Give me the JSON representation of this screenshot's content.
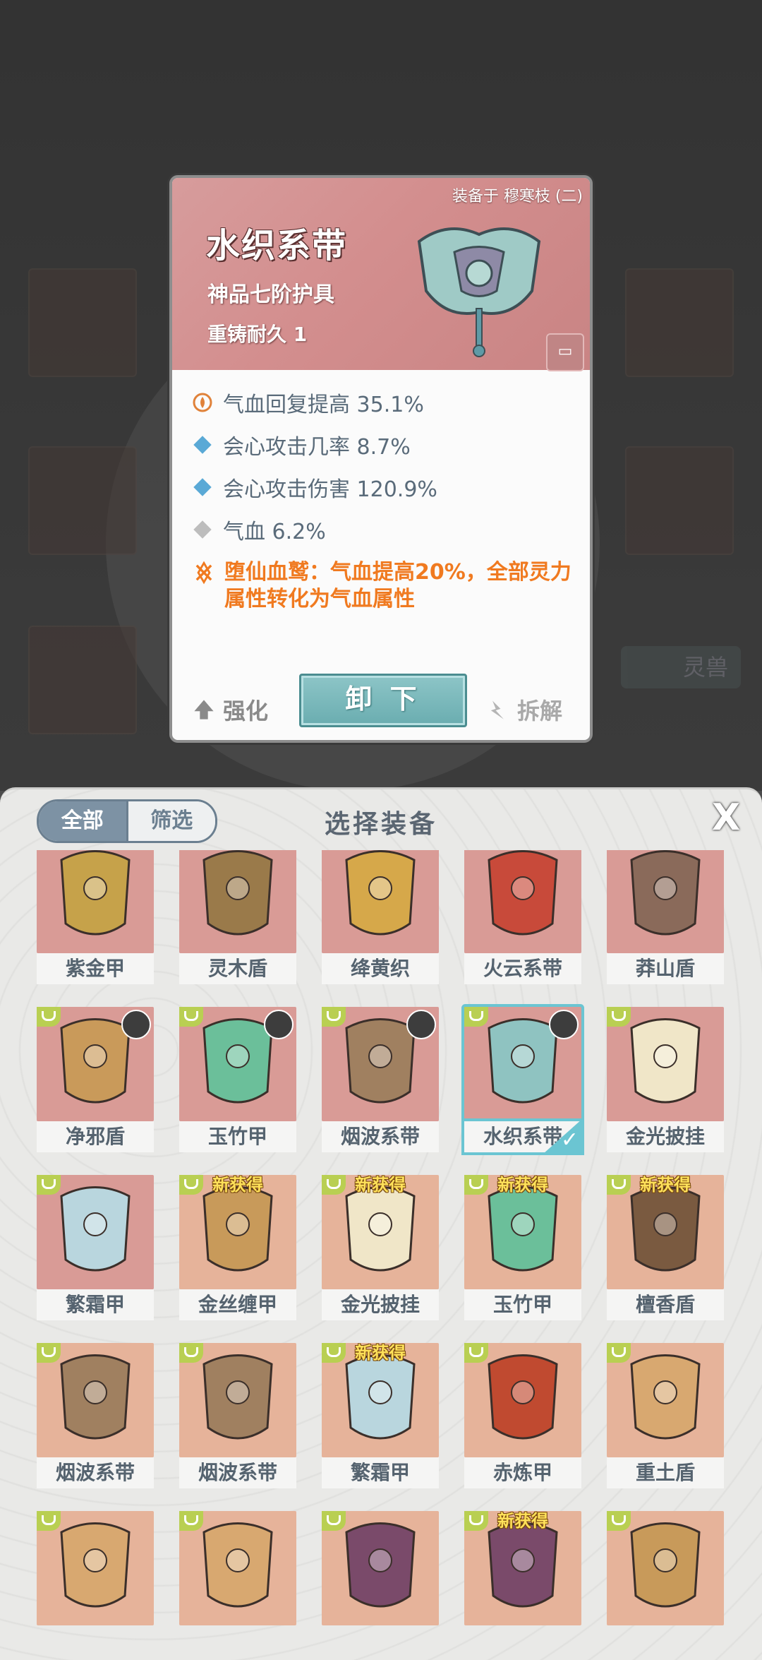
{
  "detail": {
    "equipped_on": "装备于 穆寒枝 (二)",
    "name": "水织系带",
    "grade": "神品七阶护具",
    "recast": "重铸耐久 1",
    "stats": [
      {
        "text": "气血回复提高 35.1%",
        "icon": "recovery-icon",
        "color": "#e0823a"
      },
      {
        "text": "会心攻击几率 8.7%",
        "icon": "diamond-icon",
        "color": "#5aa9d6"
      },
      {
        "text": "会心攻击伤害 120.9%",
        "icon": "diamond-icon",
        "color": "#5aa9d6"
      },
      {
        "text": "气血 6.2%",
        "icon": "diamond-icon",
        "color": "#b8b8b8"
      }
    ],
    "special": "堕仙血鹫：气血提高20%，全部灵力属性转化为气血属性",
    "strengthen_label": "强化",
    "unequip_label": "卸 下",
    "decompose_label": "拆解"
  },
  "background": {
    "side_label": "灵兽"
  },
  "panel": {
    "title": "选择装备",
    "filter_all": "全部",
    "filter_screen": "筛选",
    "close": "X",
    "new_badge": "新获得",
    "items": [
      {
        "name": "紫金甲",
        "bg": "red",
        "art": "#c6a24a",
        "tag": false,
        "new": false,
        "avatar": false
      },
      {
        "name": "灵木盾",
        "bg": "red",
        "art": "#9a7a4a",
        "tag": false,
        "new": false,
        "avatar": false
      },
      {
        "name": "绛黄织",
        "bg": "red",
        "art": "#d6a84a",
        "tag": false,
        "new": false,
        "avatar": false
      },
      {
        "name": "火云系带",
        "bg": "red",
        "art": "#c84a3a",
        "tag": false,
        "new": false,
        "avatar": false
      },
      {
        "name": "莽山盾",
        "bg": "red",
        "art": "#8a6a5a",
        "tag": false,
        "new": false,
        "avatar": false
      },
      {
        "name": "净邪盾",
        "bg": "red",
        "art": "#c99a5a",
        "tag": true,
        "new": false,
        "avatar": true
      },
      {
        "name": "玉竹甲",
        "bg": "red",
        "art": "#6bbf9a",
        "tag": true,
        "new": false,
        "avatar": true
      },
      {
        "name": "烟波系带",
        "bg": "red",
        "art": "#a08060",
        "tag": true,
        "new": false,
        "avatar": true
      },
      {
        "name": "水织系带",
        "bg": "red",
        "art": "#8fc3c1",
        "tag": true,
        "new": false,
        "avatar": true,
        "selected": true
      },
      {
        "name": "金光披挂",
        "bg": "red",
        "art": "#f0e6c8",
        "tag": true,
        "new": false,
        "avatar": false
      },
      {
        "name": "繁霜甲",
        "bg": "red",
        "art": "#b9d6de",
        "tag": true,
        "new": false,
        "avatar": false
      },
      {
        "name": "金丝缠甲",
        "bg": "orange",
        "art": "#c89a5a",
        "tag": true,
        "new": true,
        "avatar": false
      },
      {
        "name": "金光披挂",
        "bg": "orange",
        "art": "#f0e6c8",
        "tag": true,
        "new": true,
        "avatar": false
      },
      {
        "name": "玉竹甲",
        "bg": "orange",
        "art": "#6bbf9a",
        "tag": true,
        "new": true,
        "avatar": false
      },
      {
        "name": "檀香盾",
        "bg": "orange",
        "art": "#7a5a40",
        "tag": true,
        "new": true,
        "avatar": false
      },
      {
        "name": "烟波系带",
        "bg": "orange",
        "art": "#a08060",
        "tag": true,
        "new": false,
        "avatar": false
      },
      {
        "name": "烟波系带",
        "bg": "orange",
        "art": "#a08060",
        "tag": true,
        "new": false,
        "avatar": false
      },
      {
        "name": "繁霜甲",
        "bg": "orange",
        "art": "#b9d6de",
        "tag": true,
        "new": true,
        "avatar": false
      },
      {
        "name": "赤炼甲",
        "bg": "orange",
        "art": "#c04a30",
        "tag": true,
        "new": false,
        "avatar": false
      },
      {
        "name": "重土盾",
        "bg": "orange",
        "art": "#d8a870",
        "tag": true,
        "new": false,
        "avatar": false
      },
      {
        "name": "",
        "bg": "orange",
        "art": "#d8a870",
        "tag": true,
        "new": false,
        "avatar": false
      },
      {
        "name": "",
        "bg": "orange",
        "art": "#d8a870",
        "tag": true,
        "new": false,
        "avatar": false
      },
      {
        "name": "",
        "bg": "orange",
        "art": "#7a4a6a",
        "tag": true,
        "new": false,
        "avatar": false
      },
      {
        "name": "",
        "bg": "orange",
        "art": "#7a4a6a",
        "tag": true,
        "new": true,
        "avatar": false
      },
      {
        "name": "",
        "bg": "orange",
        "art": "#c89a5a",
        "tag": true,
        "new": false,
        "avatar": false
      }
    ]
  }
}
